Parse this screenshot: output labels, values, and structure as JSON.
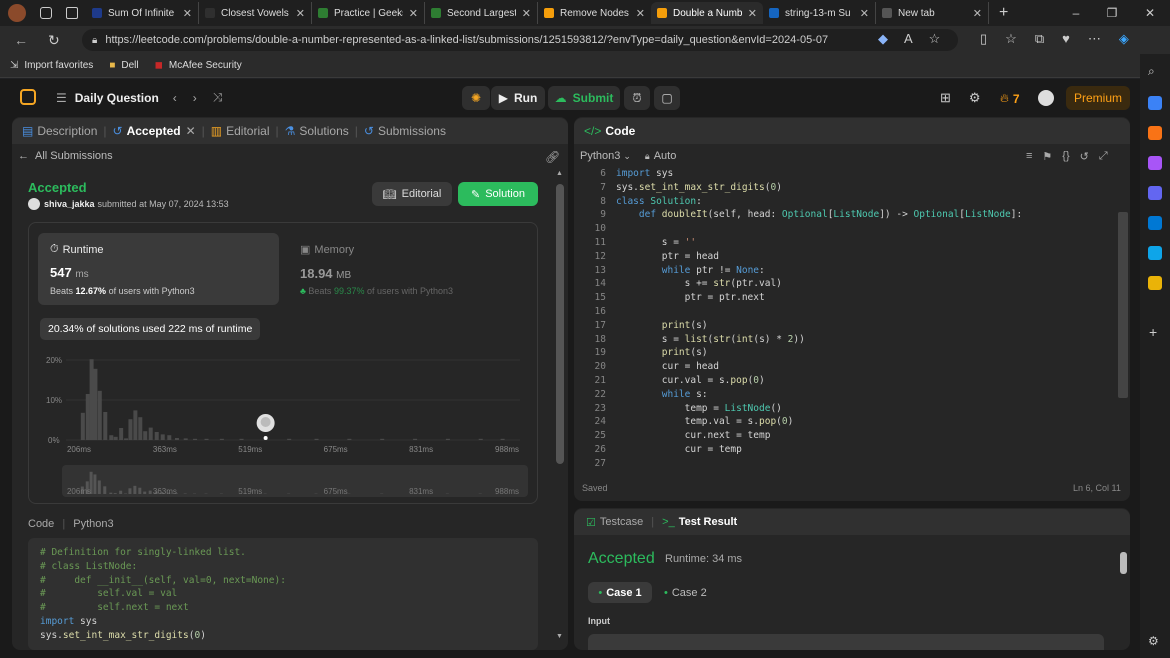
{
  "browser": {
    "tabs": [
      {
        "title": "Sum Of Infinite",
        "color": "#1e3a8a"
      },
      {
        "title": "Closest Vowels",
        "color": "#2f2f2f"
      },
      {
        "title": "Practice | Geeks",
        "color": "#2e7d32"
      },
      {
        "title": "Second Largest",
        "color": "#2e7d32"
      },
      {
        "title": "Remove Nodes",
        "color": "#f59e0b"
      },
      {
        "title": "Double a Numb",
        "color": "#f59e0b"
      },
      {
        "title": "string-13-m Su",
        "color": "#1565c0"
      },
      {
        "title": "New tab",
        "color": "#555555"
      }
    ],
    "url": "https://leetcode.com/problems/double-a-number-represented-as-a-linked-list/submissions/1251593812/?envType=daily_question&envId=2024-05-07",
    "bookmarks": [
      "Import favorites",
      "Dell",
      "McAfee Security"
    ]
  },
  "header": {
    "daily": "Daily Question",
    "run": "Run",
    "submit": "Submit",
    "streak": "7",
    "premium": "Premium"
  },
  "left": {
    "tabs": [
      "Description",
      "Accepted",
      "Editorial",
      "Solutions",
      "Submissions"
    ],
    "back": "All Submissions",
    "status": "Accepted",
    "user": "shiva_jakka",
    "submitted": "submitted at May 07, 2024 13:53",
    "editorial_btn": "Editorial",
    "solution_btn": "Solution",
    "runtime_label": "Runtime",
    "runtime_value": "547",
    "runtime_unit": "ms",
    "runtime_beats_pre": "Beats",
    "runtime_beats": "12.67%",
    "runtime_beats_post": "of users with Python3",
    "memory_label": "Memory",
    "memory_value": "18.94",
    "memory_unit": "MB",
    "memory_beats_pre": "Beats",
    "memory_beats": "99.37%",
    "memory_beats_post": "of users with Python3",
    "tooltip": "20.34% of solutions used 222 ms of runtime",
    "code_label": "Code",
    "code_lang": "Python3",
    "code_lines": [
      "# Definition for singly-linked list.",
      "# class ListNode:",
      "#     def __init__(self, val=0, next=None):",
      "#         self.val = val",
      "#         self.next = next",
      "import sys",
      "sys.set_int_max_str_digits(0)"
    ]
  },
  "chart_data": {
    "type": "bar",
    "ylabels": [
      "20%",
      "10%",
      "0%"
    ],
    "yticks": [
      20,
      10,
      0
    ],
    "ylim": [
      0,
      20
    ],
    "xlabels": [
      "206ms",
      "363ms",
      "519ms",
      "675ms",
      "831ms",
      "988ms"
    ],
    "xlim": [
      206,
      988
    ],
    "x": [
      213,
      222,
      229,
      236,
      244,
      254,
      265,
      273,
      283,
      292,
      300,
      309,
      318,
      327,
      337,
      348,
      359,
      371,
      385,
      401,
      418,
      439,
      467,
      503,
      547,
      590,
      640,
      700,
      760,
      820,
      880,
      940,
      980
    ],
    "values": [
      6.8,
      11.5,
      20.2,
      17.8,
      12.3,
      7.0,
      1.2,
      0.8,
      3.0,
      0.4,
      5.2,
      7.4,
      5.7,
      2.2,
      3.1,
      2.0,
      1.4,
      1.2,
      0.5,
      0.4,
      0.3,
      0.3,
      0.3,
      0.3,
      0.3,
      0.3,
      0.3,
      0.3,
      0.3,
      0.3,
      0.3,
      0.3,
      0.3
    ],
    "marker_x": 547
  },
  "right": {
    "title": "Code",
    "lang": "Python3",
    "mode": "Auto",
    "saved": "Saved",
    "pos": "Ln 6, Col 11",
    "start_line": 6,
    "lines": [
      "import sys",
      "sys.set_int_max_str_digits(0)",
      "class Solution:",
      "    def doubleIt(self, head: Optional[ListNode]) -> Optional[ListNode]:",
      "",
      "        s = ''",
      "        ptr = head",
      "        while ptr != None:",
      "            s += str(ptr.val)",
      "            ptr = ptr.next",
      "",
      "        print(s)",
      "        s = list(str(int(s) * 2))",
      "        print(s)",
      "        cur = head",
      "        cur.val = s.pop(0)",
      "        while s:",
      "            temp = ListNode()",
      "            temp.val = s.pop(0)",
      "            cur.next = temp",
      "            cur = temp",
      ""
    ],
    "testcase": "Testcase",
    "test_result": "Test Result",
    "result_status": "Accepted",
    "result_runtime": "Runtime: 34 ms",
    "case1": "Case 1",
    "case2": "Case 2",
    "input_label": "Input"
  }
}
